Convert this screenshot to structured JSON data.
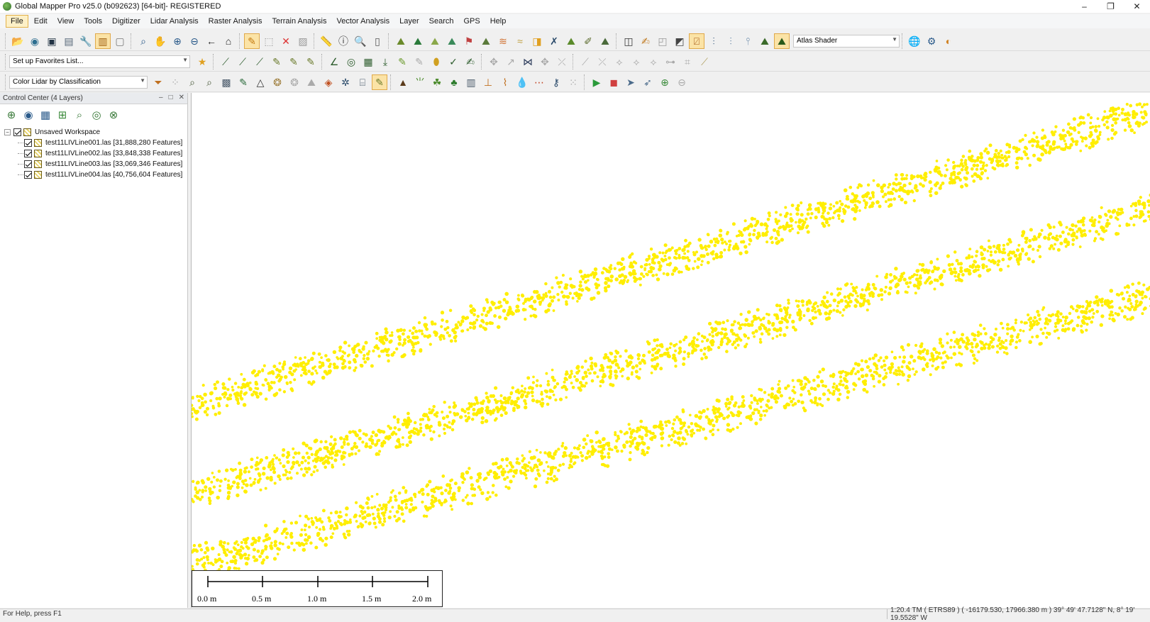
{
  "window": {
    "title": "Global Mapper Pro v25.0 (b092623) [64-bit]- REGISTERED",
    "controls": [
      "–",
      "❐",
      "✕"
    ]
  },
  "menu": [
    "File",
    "Edit",
    "View",
    "Tools",
    "Digitizer",
    "Lidar Analysis",
    "Raster Analysis",
    "Terrain Analysis",
    "Vector Analysis",
    "Layer",
    "Search",
    "GPS",
    "Help"
  ],
  "toolbar": {
    "shader": "Atlas Shader",
    "favorites": "Set up Favorites List...",
    "lidar_color": "Color Lidar by Classification"
  },
  "control_center": {
    "title": "Control Center (4 Layers)",
    "workspace": "Unsaved Workspace",
    "layers": [
      "test11LIVLine001.las [31,888,280 Features]",
      "test11LIVLine002.las [33,848,338 Features]",
      "test11LIVLine003.las [33,069,346 Features]",
      "test11LIVLine004.las [40,756,604 Features]"
    ]
  },
  "scale": {
    "labels": [
      "0.0 m",
      "0.5 m",
      "1.0 m",
      "1.5 m",
      "2.0 m"
    ]
  },
  "status": {
    "help": "For Help, press F1",
    "coords": "1:20.4  TM ( ETRS89 ) ( -16179.530, 17966.380 m )  39° 49' 47.7128\" N, 8° 19' 19.5528\" W"
  },
  "colors": {
    "lidar_points": "#ffee00",
    "map_background": "#ffffff"
  }
}
